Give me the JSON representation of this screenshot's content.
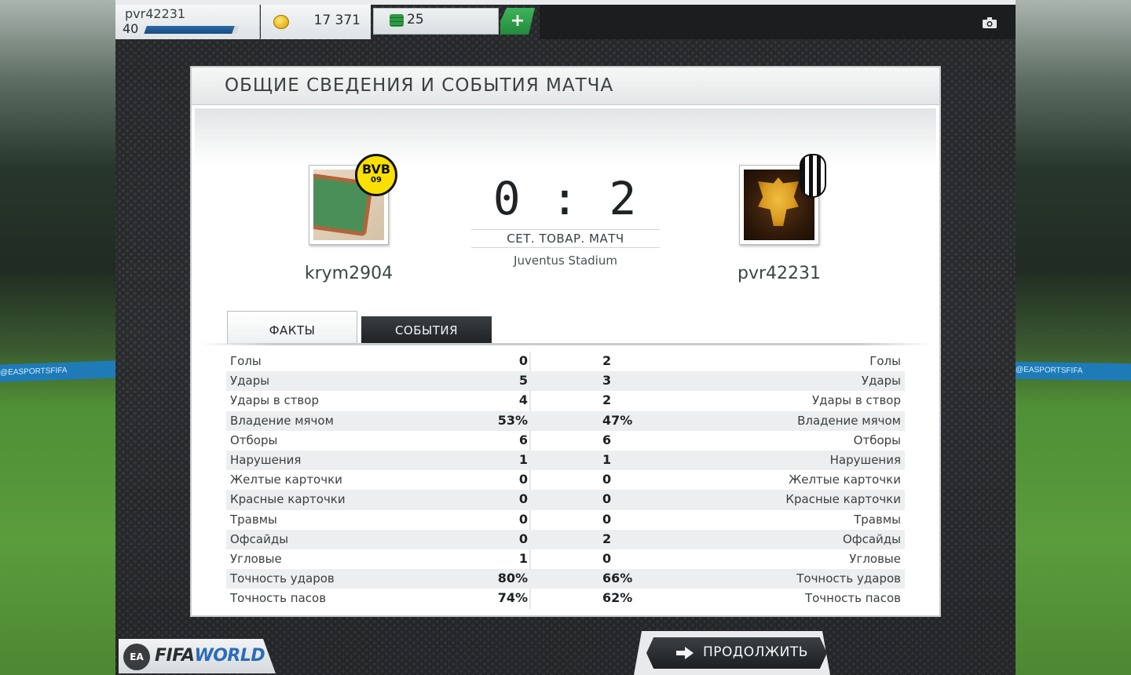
{
  "topbar": {
    "username": "pvr42231",
    "level": "40",
    "xp_fraction": 0.95,
    "coins": "17 371",
    "points": "25",
    "plus_label": "+"
  },
  "background": {
    "ad_text": "@EASPORTSFIFA",
    "ad_text_right": "@EASPORTSFIFA"
  },
  "panel": {
    "title": "ОБЩИЕ СВЕДЕНИЯ И СОБЫТИЯ МАТЧА"
  },
  "match": {
    "home_name": "krym2904",
    "away_name": "pvr42231",
    "score": "0 : 2",
    "match_type": "СЕТ. ТОВАР. МАТЧ",
    "stadium": "Juventus Stadium",
    "home_badge_text": "BVB",
    "home_badge_sub": "09"
  },
  "tabs": {
    "facts": "ФАКТЫ",
    "events": "СОБЫТИЯ"
  },
  "stats": [
    {
      "label": "Голы",
      "home": "0",
      "away": "2"
    },
    {
      "label": "Удары",
      "home": "5",
      "away": "3"
    },
    {
      "label": "Удары в створ",
      "home": "4",
      "away": "2"
    },
    {
      "label": "Владение мячом",
      "home": "53%",
      "away": "47%"
    },
    {
      "label": "Отборы",
      "home": "6",
      "away": "6"
    },
    {
      "label": "Нарушения",
      "home": "1",
      "away": "1"
    },
    {
      "label": "Желтые карточки",
      "home": "0",
      "away": "0"
    },
    {
      "label": "Красные карточки",
      "home": "0",
      "away": "0"
    },
    {
      "label": "Травмы",
      "home": "0",
      "away": "0"
    },
    {
      "label": "Офсайды",
      "home": "0",
      "away": "2"
    },
    {
      "label": "Угловые",
      "home": "1",
      "away": "0"
    },
    {
      "label": "Точность ударов",
      "home": "80%",
      "away": "66%"
    },
    {
      "label": "Точность пасов",
      "home": "74%",
      "away": "62%"
    }
  ],
  "footer": {
    "ea_text": "EA",
    "fifa_text": "FIFA",
    "world_text": "WORLD",
    "continue_label": "ПРОДОЛЖИТЬ"
  },
  "colors": {
    "accent_green": "#2f9a45",
    "xp_blue": "#174a80",
    "dark_button": "#1d2022"
  }
}
